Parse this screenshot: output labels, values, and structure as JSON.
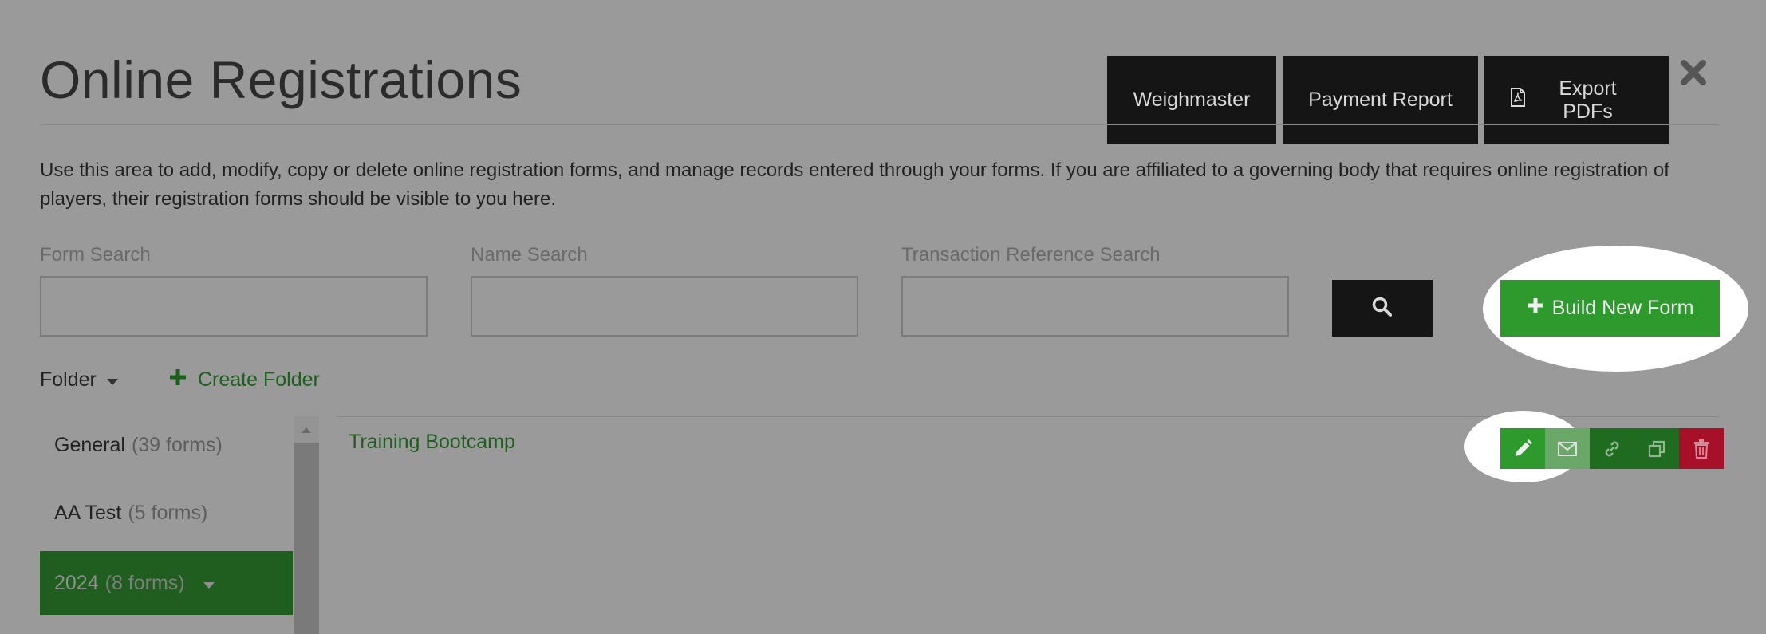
{
  "header": {
    "title": "Online Registrations",
    "buttons": {
      "weighmaster": "Weighmaster",
      "payment_report": "Payment Report",
      "export_pdfs": "Export PDFs"
    },
    "close_icon": "close-icon"
  },
  "description": "Use this area to add, modify, copy or delete online registration forms, and manage records entered through your forms. If you are affiliated to a governing body that requires online registration of players, their registration forms should be visible to you here.",
  "search": {
    "form_search_label": "Form Search",
    "form_search_value": "",
    "name_search_label": "Name Search",
    "name_search_value": "",
    "transaction_search_label": "Transaction Reference Search",
    "transaction_search_value": "",
    "search_icon": "search-icon"
  },
  "build_new_form": "Build New Form",
  "folders": {
    "folder_label": "Folder",
    "create_folder": "Create Folder",
    "items": [
      {
        "name": "General",
        "count": "(39 forms)"
      },
      {
        "name": "AA Test",
        "count": "(5 forms)"
      },
      {
        "name": "2024",
        "count": "(8 forms)"
      }
    ]
  },
  "forms": [
    {
      "name": "Training Bootcamp",
      "actions": [
        "edit-icon",
        "email-icon",
        "link-icon",
        "copy-icon",
        "delete-icon"
      ]
    }
  ],
  "colors": {
    "overlay": "#9a9a9a",
    "dark_button": "#151515",
    "green_primary": "#2e9a2e",
    "green_dark": "#1f5e1f",
    "delete_red": "#a8102a",
    "highlight": "#ffffff"
  }
}
